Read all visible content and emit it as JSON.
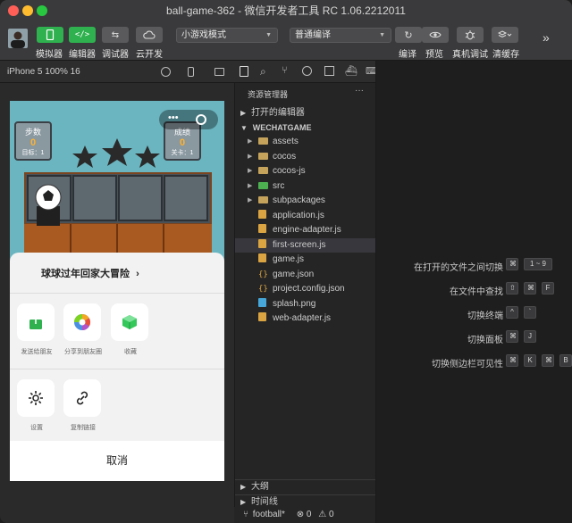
{
  "window": {
    "title": "ball-game-362 - 微信开发者工具 RC 1.06.2212011"
  },
  "toolbar": {
    "simulator_label": "模拟器",
    "editor_label": "编辑器",
    "debugger_label": "调试器",
    "cloud_label": "云开发",
    "mode_select": "小游戏模式",
    "compile_select": "普通编译",
    "compile_label": "编译",
    "preview_label": "预览",
    "remote_debug_label": "真机调试",
    "clear_cache_label": "清缓存"
  },
  "simulator": {
    "device_label": "iPhone 5 100% 16",
    "game": {
      "steps_label": "步数",
      "steps_value": "0",
      "target_label": "目标：1",
      "score_label": "成绩",
      "score_value": "0",
      "level_label": "关卡：1"
    },
    "share_sheet": {
      "title": "球球过年回家大冒险",
      "items": [
        {
          "label": "发送给朋友",
          "icon": "share-up-icon"
        },
        {
          "label": "分享到朋友圈",
          "icon": "moments-icon"
        },
        {
          "label": "收藏",
          "icon": "favorite-cube-icon"
        }
      ],
      "items2": [
        {
          "label": "设置",
          "icon": "gear-icon"
        },
        {
          "label": "复制链接",
          "icon": "link-icon"
        }
      ],
      "cancel_label": "取消"
    }
  },
  "explorer": {
    "title": "资源管理器",
    "open_editors_label": "打开的编辑器",
    "project_label": "WECHATGAME",
    "files": [
      {
        "name": "assets",
        "type": "folder"
      },
      {
        "name": "cocos",
        "type": "folder"
      },
      {
        "name": "cocos-js",
        "type": "folder"
      },
      {
        "name": "src",
        "type": "folder-src"
      },
      {
        "name": "subpackages",
        "type": "folder"
      },
      {
        "name": "application.js",
        "type": "js"
      },
      {
        "name": "engine-adapter.js",
        "type": "js"
      },
      {
        "name": "first-screen.js",
        "type": "js"
      },
      {
        "name": "game.js",
        "type": "js"
      },
      {
        "name": "game.json",
        "type": "json"
      },
      {
        "name": "project.config.json",
        "type": "json"
      },
      {
        "name": "splash.png",
        "type": "image"
      },
      {
        "name": "web-adapter.js",
        "type": "js"
      }
    ],
    "outline_label": "大纲",
    "timeline_label": "时间线"
  },
  "status": {
    "branch": "football*",
    "errors": "0",
    "warnings": "0"
  },
  "shortcuts": [
    {
      "label": "在打开的文件之间切换",
      "keys": [
        "⌘",
        "1 ~ 9"
      ]
    },
    {
      "label": "在文件中查找",
      "keys": [
        "⇧",
        "⌘",
        "F"
      ]
    },
    {
      "label": "切换终端",
      "keys": [
        "^",
        "`"
      ]
    },
    {
      "label": "切换面板",
      "keys": [
        "⌘",
        "J"
      ]
    },
    {
      "label": "切换侧边栏可见性",
      "keys": [
        "⌘",
        "K",
        "⌘",
        "B"
      ]
    }
  ],
  "colors": {
    "accent_green": "#2fb14f",
    "selected_row": "#37373d"
  }
}
